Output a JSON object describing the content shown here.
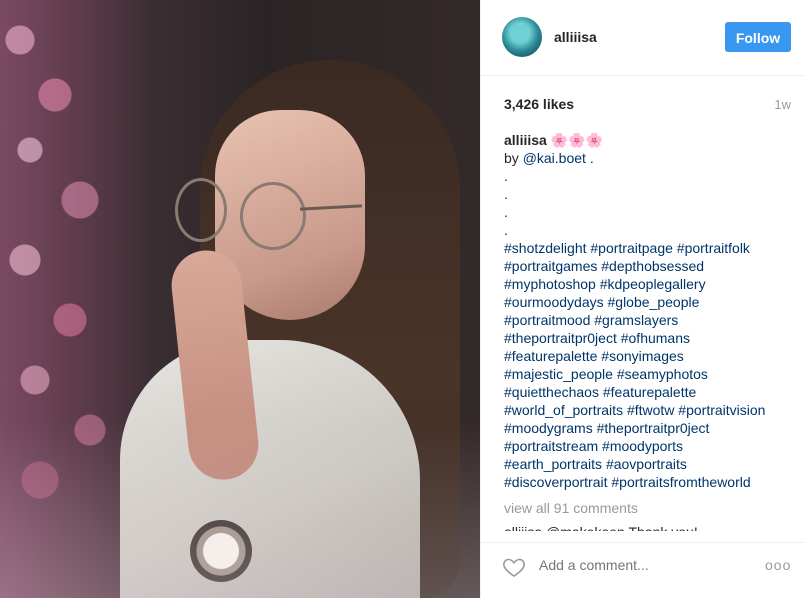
{
  "header": {
    "username": "alliiisa",
    "follow_label": "Follow"
  },
  "stats": {
    "likes": "3,426 likes",
    "time": "1w"
  },
  "caption": {
    "username": "alliiisa",
    "emoji": "🌸🌸🌸",
    "by_text": "by",
    "mention": "@kai.boet",
    "mention_suffix": " .",
    "dots": [
      ".",
      ".",
      ".",
      "."
    ],
    "hashtag_lines": [
      "#shotzdelight #portraitpage #portraitfolk",
      "#portraitgames #depthobsessed",
      "#myphotoshop #kdpeoplegallery",
      "#ourmoodydays #globe_people",
      "#portraitmood #gramslayers",
      "#theportraitpr0ject #ofhumans",
      "#featurepalette #sonyimages",
      "#majestic_people #seamyphotos",
      "#quietthechaos #featurepalette",
      "#world_of_portraits #ftwotw #portraitvision",
      "#moodygrams #theportraitpr0ject",
      "#portraitstream #moodyports",
      "#earth_portraits #aovportraits",
      "#discoverportrait #portraitsfromtheworld"
    ]
  },
  "comments": {
    "view_all": "view all 91 comments",
    "partial_comment": "alliiisa @makekeen Thank you!"
  },
  "footer": {
    "add_comment_placeholder": "Add a comment...",
    "more": "ooo"
  },
  "colors": {
    "follow_blue": "#3897f0",
    "link": "#003569",
    "muted": "#999999"
  },
  "icons": [
    "heart-icon",
    "more-options-icon"
  ]
}
